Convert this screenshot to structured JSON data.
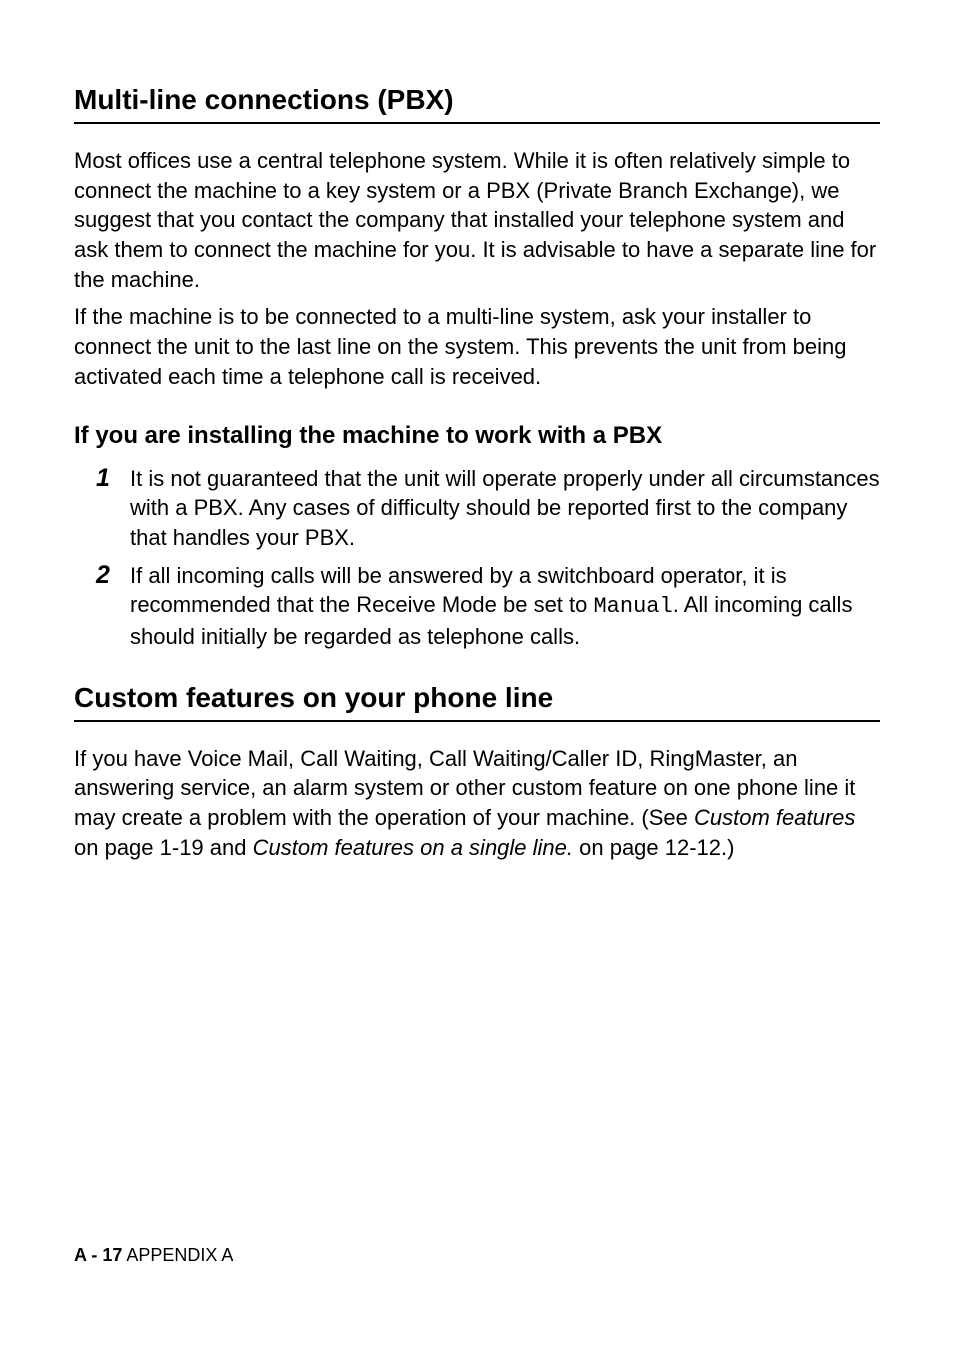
{
  "headings": {
    "h1": "Multi-line connections (PBX)",
    "h2": "Custom features on your phone line",
    "h3": "If you are installing the machine to work with a PBX"
  },
  "paragraphs": {
    "p1": "Most offices use a central telephone system. While it is often relatively simple to connect the machine to a key system or a PBX (Private Branch Exchange), we suggest that you contact the company that installed your telephone system and ask them to connect the machine for you. It is advisable to have a separate line for the machine.",
    "p2": "If the machine is to be connected to a multi-line system, ask your installer to connect the unit to the last line on the system. This prevents the unit from being activated each time a telephone call is received."
  },
  "list": {
    "item1": {
      "num": "1",
      "text": "It is not guaranteed that the unit will operate properly under all circumstances with a PBX. Any cases of difficulty should be reported first to the company that handles your PBX."
    },
    "item2": {
      "num": "2",
      "text_part1": "If all incoming calls will be answered by a switchboard operator, it is recommended that the Receive Mode be set to ",
      "mono": "Manual",
      "text_part2": ". All incoming calls should initially be regarded as telephone calls."
    }
  },
  "custom_para": {
    "part1": "If you have Voice Mail, Call Waiting, Call Waiting/Caller ID, RingMaster, an answering service, an alarm system or other custom feature on one phone line it may create a problem with the operation of your machine. (See ",
    "italic1": "Custom features",
    "part2": " on page 1-19 and ",
    "italic2": "Custom features on a single line.",
    "part3": " on page 12-12.)"
  },
  "footer": {
    "page": "A - 17",
    "label": "   APPENDIX A"
  }
}
